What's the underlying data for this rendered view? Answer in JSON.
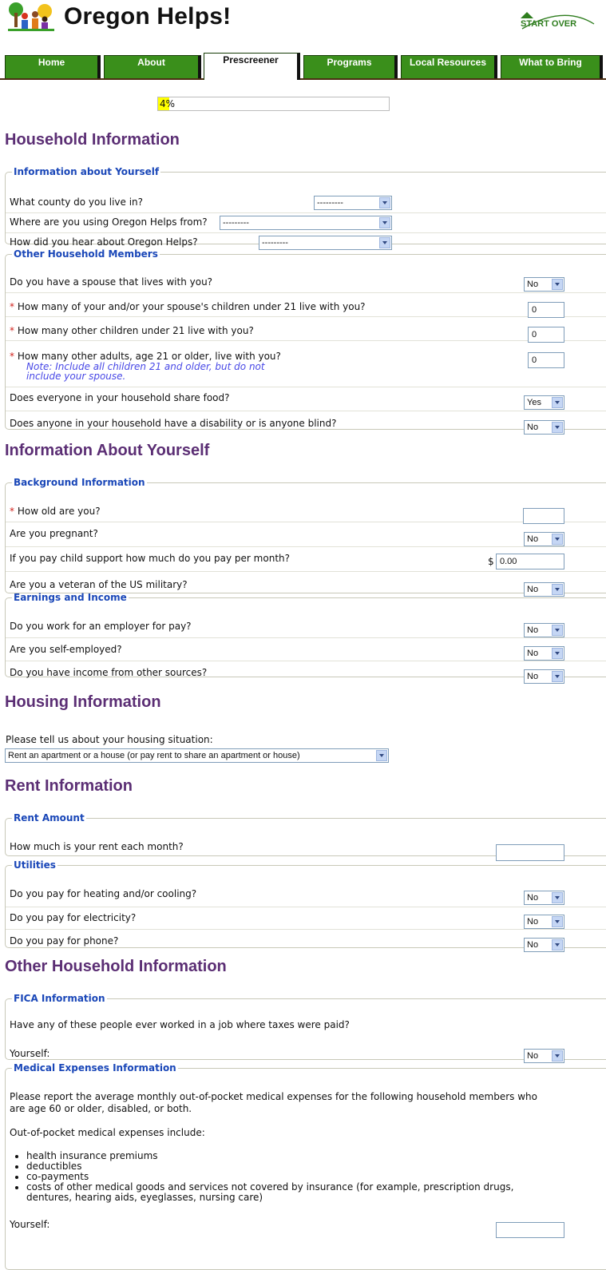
{
  "header": {
    "title": "Oregon Helps!",
    "start_over": "START OVER"
  },
  "tabs": [
    "Home",
    "About",
    "Prescreener",
    "Programs",
    "Local Resources",
    "What to Bring"
  ],
  "progress": {
    "percent": 4,
    "label": "4%"
  },
  "sections": {
    "household": "Household Information",
    "about_yourself": "Information About Yourself",
    "housing": "Housing Information",
    "rent": "Rent Information",
    "other": "Other Household Information"
  },
  "info_yourself": {
    "legend": "Information about Yourself",
    "county_q": "What county do you live in?",
    "county_v": "---------",
    "where_q": "Where are you using Oregon Helps from?",
    "where_v": "---------",
    "hear_q": "How did you hear about Oregon Helps?",
    "hear_v": "---------"
  },
  "other_members": {
    "legend": "Other Household Members",
    "spouse_q": "Do you have a spouse that lives with you?",
    "spouse_v": "No",
    "children_q": "How many of your and/or your spouse's children under 21 live with you?",
    "children_v": "0",
    "other_children_q": "How many other children under 21 live with you?",
    "other_children_v": "0",
    "adults_q": "How many other adults, age 21 or older, live with you?",
    "adults_v": "0",
    "note1": "Note: Include all children 21 and older, but do not",
    "note2": "include your spouse.",
    "share_food_q": "Does everyone in your household share food?",
    "share_food_v": "Yes",
    "disability_q": "Does anyone in your household have a disability or is anyone blind?",
    "disability_v": "No"
  },
  "background": {
    "legend": "Background Information",
    "age_q": "How old are you?",
    "age_v": "",
    "pregnant_q": "Are you pregnant?",
    "pregnant_v": "No",
    "child_support_q": "If you pay child support how much do you pay per month?",
    "currency": "$",
    "child_support_v": "0.00",
    "veteran_q": "Are you a veteran of the US military?",
    "veteran_v": "No"
  },
  "earnings": {
    "legend": "Earnings and Income",
    "employer_q": "Do you work for an employer for pay?",
    "employer_v": "No",
    "self_q": "Are you self-employed?",
    "self_v": "No",
    "other_q": "Do you have income from other sources?",
    "other_v": "No"
  },
  "housing": {
    "prompt": "Please tell us about your housing situation:",
    "value": "Rent an apartment or a house (or pay rent to share an apartment or house)"
  },
  "rent_amount": {
    "legend": "Rent Amount",
    "q": "How much is your rent each month?",
    "v": ""
  },
  "utilities": {
    "legend": "Utilities",
    "heating_q": "Do you pay for heating and/or cooling?",
    "heating_v": "No",
    "electricity_q": "Do you pay for electricity?",
    "electricity_v": "No",
    "phone_q": "Do you pay for phone?",
    "phone_v": "No"
  },
  "fica": {
    "legend": "FICA Information",
    "q": "Have any of these people ever worked in a job where taxes were paid?",
    "yourself": "Yourself:",
    "yourself_v": "No"
  },
  "medical": {
    "legend": "Medical Expenses Information",
    "p1a": "Please report the average monthly out-of-pocket medical expenses for the following household members who",
    "p1b": "are age 60 or older, disabled, or both.",
    "p2": "Out-of-pocket medical expenses include:",
    "items": [
      "health insurance premiums",
      "deductibles",
      "co-payments",
      "costs of other medical goods and services not covered by insurance (for example, prescription drugs,",
      "dentures, hearing aids, eyeglasses, nursing care)"
    ],
    "yourself": "Yourself:",
    "yourself_v": ""
  }
}
